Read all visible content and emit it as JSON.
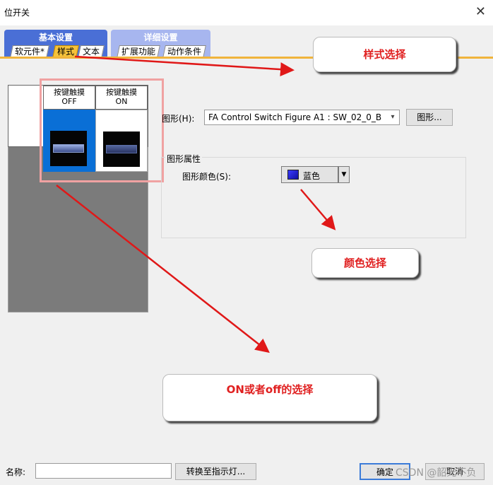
{
  "window": {
    "title": "位开关"
  },
  "tabs": {
    "basic": {
      "title": "基本设置",
      "sub": [
        "软元件*",
        "样式",
        "文本"
      ],
      "active": "样式"
    },
    "detail": {
      "title": "详细设置",
      "sub": [
        "扩展功能",
        "动作条件"
      ]
    }
  },
  "states": [
    {
      "label1": "按键触摸",
      "label2": "OFF"
    },
    {
      "label1": "按键触摸",
      "label2": "ON"
    }
  ],
  "figure": {
    "label": "图形(H):",
    "value": "FA Control Switch Figure A1 : SW_02_0_B",
    "button": "图形..."
  },
  "figure_props": {
    "group_title": "图形属性",
    "color_label": "图形颜色(S):",
    "color_value": "蓝色",
    "color_hex": "#2a2ad8"
  },
  "annotations": {
    "style": "样式选择",
    "color": "颜色选择",
    "onoff": "ON或者off的选择"
  },
  "bottom": {
    "name_label": "名称:",
    "convert_button": "转换至指示灯...",
    "ok_button": "确定",
    "cancel_button": "取消"
  },
  "watermark": "CSDN @韶光不负"
}
